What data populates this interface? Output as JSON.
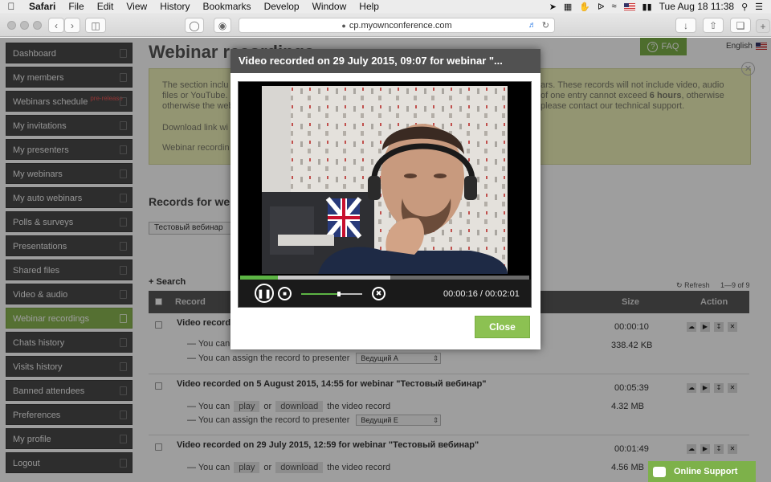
{
  "menubar": {
    "app": "Safari",
    "menus": [
      "File",
      "Edit",
      "View",
      "History",
      "Bookmarks",
      "Develop",
      "Window",
      "Help"
    ],
    "clock": "Tue Aug 18  11:38"
  },
  "browser": {
    "url": "cp.myownconference.com"
  },
  "sidebar": {
    "items": [
      {
        "label": "Dashboard"
      },
      {
        "label": "My members"
      },
      {
        "label": "Webinars schedule",
        "badge": "pre-release"
      },
      {
        "label": "My invitations"
      },
      {
        "label": "My presenters"
      },
      {
        "label": "My webinars"
      },
      {
        "label": "My auto webinars"
      },
      {
        "label": "Polls & surveys"
      },
      {
        "label": "Presentations"
      },
      {
        "label": "Shared files"
      },
      {
        "label": "Video & audio"
      },
      {
        "label": "Webinar recordings",
        "active": true
      },
      {
        "label": "Chats history"
      },
      {
        "label": "Visits history"
      },
      {
        "label": "Banned attendees"
      },
      {
        "label": "Preferences"
      },
      {
        "label": "My profile"
      },
      {
        "label": "Logout"
      }
    ]
  },
  "header": {
    "title": "Webinar recordings",
    "faq": "FAQ",
    "language": "English"
  },
  "notice": {
    "line1_left": "The section inclu",
    "line2_left": "files or YouTube.",
    "line3_left": "otherwise the webinar recor",
    "line1_right": "ars. These records will not include video, audio",
    "line2_right_pre": "of one entry cannot exceed",
    "line2_right_bold": "6 hours",
    "line2_right_post": ", otherwise",
    "line3_right": "please contact our technical support.",
    "download": "Download link wi",
    "recording": "Webinar recordin"
  },
  "records": {
    "title": "Records for webi",
    "filter": "Тестовый вебинар",
    "search": "Search",
    "refresh": "Refresh",
    "pager": "1—9 of 9",
    "columns": {
      "record": "Record",
      "size": "Size",
      "action": "Action"
    },
    "you_can": "— You can",
    "or": "or",
    "play": "play",
    "download": "download",
    "the_video_record": "the video record",
    "assign": "— You can assign the record to presenter",
    "rows": [
      {
        "title": "Video recorded",
        "duration": "00:00:10",
        "size": "338.42 KB",
        "play_line": "— You can",
        "presenter": "Ведущий А"
      },
      {
        "title": "Video recorded on 5 August 2015, 14:55 for webinar \"Тестовый вебинар\"",
        "duration": "00:05:39",
        "size": "4.32 MB",
        "presenter": "Ведущий Е"
      },
      {
        "title": "Video recorded on 29 July 2015, 12:59 for webinar \"Тестовый вебинар\"",
        "duration": "00:01:49",
        "size": "4.56 MB"
      }
    ]
  },
  "modal": {
    "title": "Video recorded on 29 July 2015, 09:07 for webinar \"...",
    "time": "00:00:16 / 00:02:01",
    "progress_fraction": 0.13,
    "buffered_fraction": 0.52,
    "volume_fraction": 0.62,
    "close": "Close"
  },
  "support": {
    "label": "Online Support"
  },
  "colors": {
    "accent_green": "#8cc152",
    "sidebar_bg": "#4a4a4a",
    "notice_bg": "#eef0b9"
  }
}
